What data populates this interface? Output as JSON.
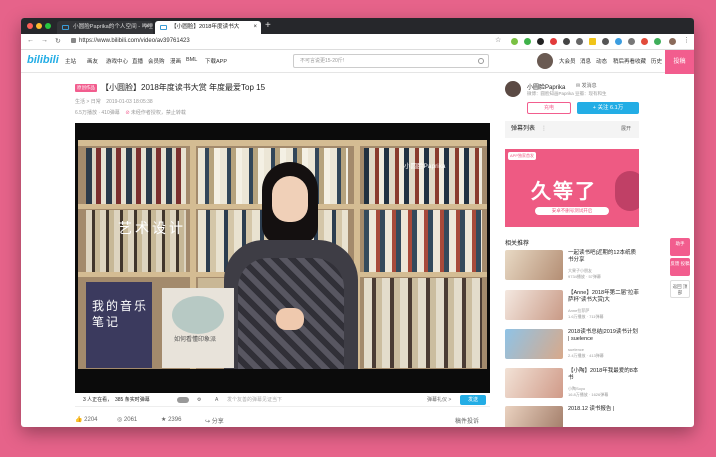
{
  "browser": {
    "tabs": [
      {
        "label": "小圆脸Paprika的个人空间 - 哔哩"
      },
      {
        "label": "【小圆脸】2018年度读书大"
      }
    ],
    "url": "https://www.bilibili.com/video/av39761423",
    "new_tab": "+"
  },
  "site": {
    "logo": "bilibili",
    "nav": [
      "主站",
      "画友",
      "游戏中心",
      "直播",
      "会员购",
      "漫画",
      "BML",
      "下载APP"
    ],
    "search_placeholder": "不可言说更15-20斤!",
    "right_nav": [
      "大会员",
      "消息",
      "动态",
      "稍后再看",
      "收藏",
      "历史"
    ],
    "upload": "投稿"
  },
  "video": {
    "badge": "原创作品",
    "title": "【小圆脸】2018年度读书大赏 年度最爱Top 15",
    "category": "生活 > 日常",
    "date": "2019-01-03 18:05:38",
    "plays": "6.5万播放",
    "danmaku_count": "410弹幕",
    "notice": "未经作者授权，禁止转载",
    "watermark": "小圆脸Paprika",
    "overlay_text": "艺术设计",
    "book1_title": "我的音乐笔记",
    "book2_title": "如何看懂印象派"
  },
  "player_controls": {
    "watching": "3 人正在看，",
    "live_danmaku": "385 条实时弹幕",
    "danmaku_placeholder": "发个友善的弹幕见证当下",
    "etiquette": "弹幕礼仪 >",
    "send": "发送"
  },
  "stats": {
    "likes": "2204",
    "coins": "2061",
    "favorites": "2396",
    "share": "分享",
    "report": "稿件投诉"
  },
  "uploader": {
    "name": "小圆脸Paprika",
    "message": "发消息",
    "desc": "微博：圆脸知画Paprika 豆瓣：现有和生",
    "charge": "充电",
    "follow": "+ 关注 6.1万"
  },
  "danmaku_list": {
    "label": "弹幕列表",
    "expand": "展开"
  },
  "ad": {
    "banner": "APP独家首发",
    "headline": "久等了",
    "sub": "安卓不删号测试开启"
  },
  "related": {
    "heading": "相关推荐",
    "items": [
      {
        "title": "一起读书吧|近期的12本纸质书分享",
        "author": "大果子小朋友",
        "views": "9734播放 · 57弹幕"
      },
      {
        "title": "【Anne】2018年第二届“拉菲萨杯”读书大赏|大",
        "author": "Anne拉菲萨",
        "views": "1.6万播放 · 711弹幕"
      },
      {
        "title": "2018读书总结|2019读书计划 | suelence",
        "author": "suelence",
        "views": "2.4万播放 · 413弹幕"
      },
      {
        "title": "【小陶】2018年我最爱的8本书",
        "author": "小陶Soyo",
        "views": "16.8万播放 · 1626弹幕"
      },
      {
        "title": "2018.12 读书报告 |",
        "author": "",
        "views": ""
      }
    ]
  },
  "float_buttons": [
    "助手",
    "反馈 投稿",
    "返回 顶部"
  ],
  "colors": {
    "brand": "#23ade5",
    "pink": "#f25d8e",
    "desktop": "#e6638a"
  }
}
